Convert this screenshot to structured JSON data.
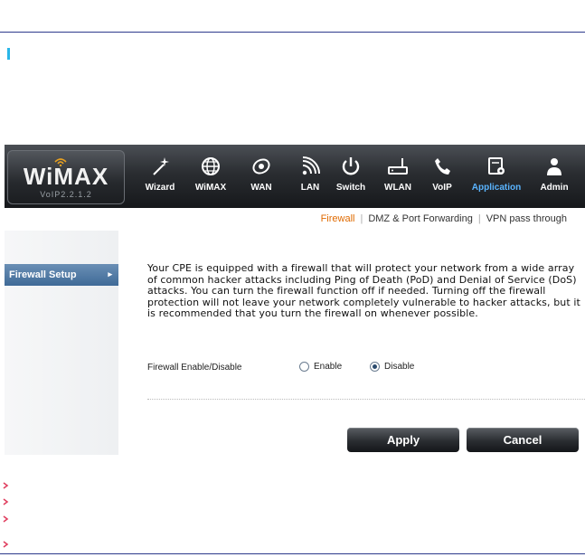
{
  "brand": {
    "name": "WiMAX",
    "version": "VoIP2.2.1.2"
  },
  "nav": [
    {
      "label": "Wizard",
      "icon": "wand-icon"
    },
    {
      "label": "WiMAX",
      "icon": "globe-icon"
    },
    {
      "label": "WAN",
      "icon": "wan-icon"
    },
    {
      "label": "LAN",
      "icon": "signal-icon"
    },
    {
      "label": "Switch",
      "icon": "power-icon"
    },
    {
      "label": "WLAN",
      "icon": "router-icon"
    },
    {
      "label": "VoIP",
      "icon": "phone-icon"
    },
    {
      "label": "Application",
      "icon": "application-icon"
    },
    {
      "label": "Admin",
      "icon": "user-icon"
    }
  ],
  "active_nav": "Application",
  "subnav": {
    "firewall": "Firewall",
    "dmz": "DMZ & Port Forwarding",
    "vpn": "VPN pass through"
  },
  "sidebar": {
    "item": "Firewall Setup"
  },
  "content": {
    "description": "Your CPE is equipped with a firewall that will protect your network from a wide array of common hacker attacks including Ping of Death (PoD) and Denial of Service (DoS) attacks. You can turn the firewall function off if needed. Turning off the firewall protection will not leave your network completely vulnerable to hacker attacks, but it is recommended that you turn the firewall on whenever possible.",
    "firewall_label": "Firewall Enable/Disable",
    "enable_label": "Enable",
    "disable_label": "Disable",
    "selected": "Disable"
  },
  "buttons": {
    "apply": "Apply",
    "cancel": "Cancel"
  },
  "colors": {
    "accent_orange": "#e06a00",
    "active_blue": "#5ab4ff",
    "rule_blue": "#2d3a8c",
    "marker_cyan": "#29b6e8"
  }
}
